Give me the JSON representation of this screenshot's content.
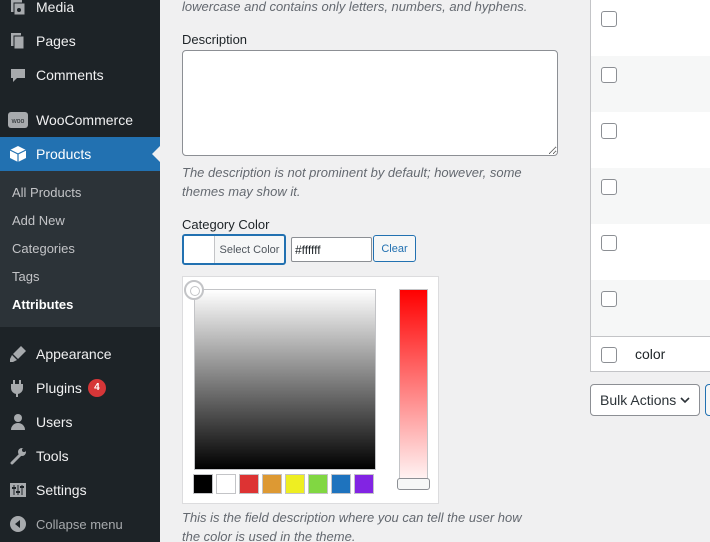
{
  "sidebar": {
    "menu": [
      {
        "label": "Media",
        "icon": "media-icon"
      },
      {
        "label": "Pages",
        "icon": "pages-icon"
      },
      {
        "label": "Comments",
        "icon": "comments-icon"
      },
      {
        "label": "WooCommerce",
        "icon": "woocommerce-icon"
      },
      {
        "label": "Products",
        "icon": "products-icon",
        "active": true
      },
      {
        "label": "Appearance",
        "icon": "appearance-icon"
      },
      {
        "label": "Plugins",
        "icon": "plugins-icon",
        "badge": "4"
      },
      {
        "label": "Users",
        "icon": "users-icon"
      },
      {
        "label": "Tools",
        "icon": "tools-icon"
      },
      {
        "label": "Settings",
        "icon": "settings-icon"
      }
    ],
    "woo_icon_text": "woo",
    "submenu": [
      "All Products",
      "Add New",
      "Categories",
      "Tags",
      "Attributes"
    ],
    "current_submenu": "Attributes",
    "collapse_label": "Collapse menu"
  },
  "form": {
    "slug_help_tail": "lowercase and contains only letters, numbers, and hyphens.",
    "description_label": "Description",
    "description_value": "",
    "description_help": "The description is not prominent by default; however, some themes may show it.",
    "color_label": "Category Color",
    "select_color_label": "Select Color",
    "hex_value": "#ffffff",
    "clear_label": "Clear",
    "palette": [
      "#000000",
      "#ffffff",
      "#dd3333",
      "#dd9933",
      "#eeee22",
      "#81d742",
      "#1e73be",
      "#8224e3"
    ],
    "color_help": "This is the field description where you can tell the user how the color is used in the theme."
  },
  "table": {
    "row_label": "color",
    "bulk_actions_label": "Bulk Actions"
  },
  "colors": {
    "sidebar_bg": "#1d2327",
    "active_bg": "#2271b1",
    "badge_bg": "#d63638"
  }
}
